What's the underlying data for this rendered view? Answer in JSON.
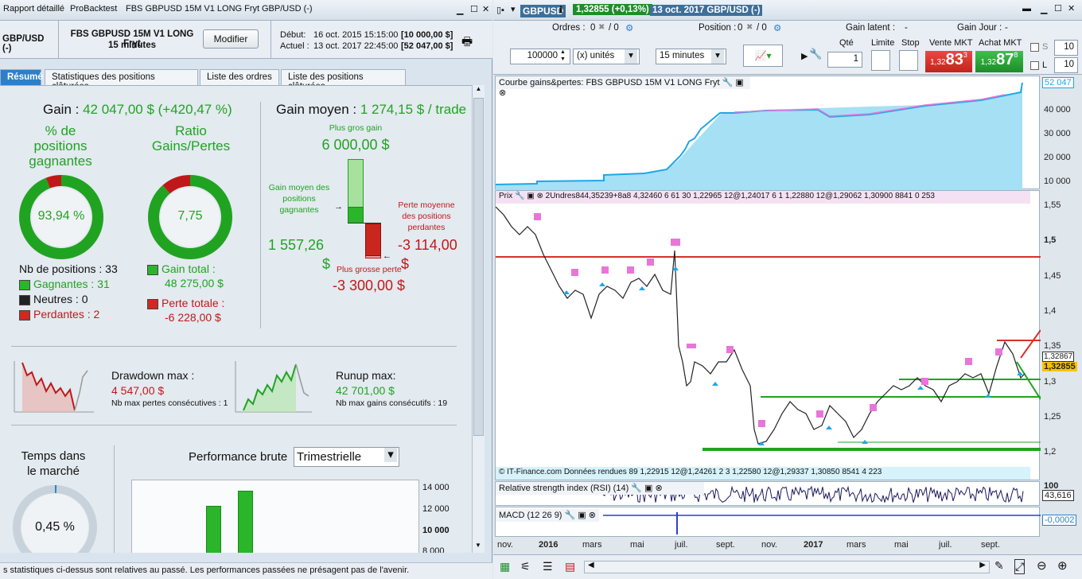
{
  "left": {
    "tabs": [
      "Rapport détaillé",
      "ProBacktest",
      "FBS GBPUSD 15M V1 LONG Fryt",
      "GBP/USD (-)"
    ],
    "instrument": "GBP/USD (-)",
    "strategy": "FBS GBPUSD 15M V1 LONG Fryt",
    "timeframe": "15 minutes",
    "modify_label": "Modifier",
    "start_label": "Début:",
    "start_date": "16 oct. 2015 15:15:00",
    "start_value": "[10 000,00 $]",
    "end_label": "Actuel :",
    "end_date": "13 oct. 2017 22:45:00",
    "end_value": "[52 047,00 $]",
    "report_tabs": [
      "Résumé",
      "Statistiques des positions clôturées",
      "Liste des ordres",
      "Liste des positions clôturées"
    ],
    "gain_label": "Gain :",
    "gain_value": "42 047,00 $ (+420,47 %)",
    "pct_win_title_1": "% de",
    "pct_win_title_2": "positions",
    "pct_win_title_3": "gagnantes",
    "pct_win_value": "93,94 %",
    "pct_win_fraction": 0.9394,
    "ratio_title_1": "Ratio",
    "ratio_title_2": "Gains/Pertes",
    "ratio_value": "7,75",
    "ratio_fraction": 0.886,
    "nb_pos": "Nb de positions : 33",
    "winners": "Gagnantes : 31",
    "neutral": "Neutres : 0",
    "losers": "Perdantes : 2",
    "gain_total_label": "Gain total :",
    "gain_total": "48 275,00 $",
    "loss_total_label": "Perte totale :",
    "loss_total": "-6 228,00 $",
    "avg_gain_label": "Gain moyen :",
    "avg_gain": "1 274,15 $ / trade",
    "biggest_gain_label": "Plus gros gain",
    "biggest_gain": "6 000,00 $",
    "avg_win_label_1": "Gain moyen des",
    "avg_win_label_2": "positions",
    "avg_win_label_3": "gagnantes",
    "avg_win_value_1": "1 557,26",
    "avg_win_value_2": "$",
    "avg_loss_label_1": "Perte moyenne",
    "avg_loss_label_2": "des positions",
    "avg_loss_label_3": "perdantes",
    "avg_loss_value_1": "-3 114,00",
    "avg_loss_value_2": "$",
    "biggest_loss_label": "Plus grosse perte",
    "biggest_loss": "-3 300,00 $",
    "drawdown_label": "Drawdown max :",
    "drawdown": "4 547,00 $",
    "drawdown_sub": "Nb max pertes consécutives : 1",
    "runup_label": "Runup max:",
    "runup": "42 701,00 $",
    "runup_sub": "Nb max gains consécutifs : 19",
    "time_title_1": "Temps dans",
    "time_title_2": "le marché",
    "time_value": "0,45 %",
    "time_fraction": 0.0045,
    "perf_label": "Performance brute",
    "perf_select": "Trimestrielle",
    "perf_axis": [
      "14 000",
      "12 000",
      "10 000",
      "8 000"
    ],
    "footer": "s statistiques ci-dessus sont relatives au passé. Les performances passées ne présagent pas de l'avenir."
  },
  "right": {
    "symbol": "GBPUSD",
    "price": "1,32855 (+0,13%)",
    "date": "13 oct. 2017 GBP/USD (-)",
    "orders_label": "Ordres :",
    "orders_a": "0",
    "orders_b": "/ 0",
    "position_label": "Position :",
    "position_a": "0",
    "position_b": "/ 0",
    "latent_label": "Gain latent :",
    "latent_value": "-",
    "day_label": "Gain Jour :",
    "day_value": "-",
    "qty_field": "100000",
    "units": "(x) unités",
    "tf": "15 minutes",
    "qte_label": "Qté",
    "qte_value": "1",
    "limit_label": "Limite",
    "stop_label": "Stop",
    "sell_label": "Vente MKT",
    "sell_small": "1,32",
    "sell_big": "83",
    "sell_sup": "3",
    "buy_label": "Achat MKT",
    "buy_small": "1,32",
    "buy_big": "87",
    "buy_sup": "8",
    "s_label": "S",
    "s_value": "10",
    "l_label": "L",
    "l_value": "10",
    "equity_title": "Courbe gains&pertes: FBS GBPUSD 15M V1 LONG Fryt",
    "equity_axis": [
      "52 047",
      "40 000",
      "30 000",
      "20 000",
      "10 000"
    ],
    "price_title": "Prix",
    "price_info": "2Undres844,35239+8a8 4,32460 6 61 30 1,22965 12@1,24017 6 1 1,22880 12@1,29062 1,30900 8841 0 253",
    "price_info2": "© IT-Finance.com Données rendues 89 1,22915 12@1,24261 2 3 1,22580 12@1,29337 1,30850 8541 4 223",
    "price_axis": [
      "1,55",
      "1,5",
      "1,45",
      "1,4",
      "1,35",
      "1,3",
      "1,25",
      "1,2"
    ],
    "current_price": "1,32855",
    "price_tag2": "1,32867",
    "rsi_title": "Relative strength index (RSI) (14)",
    "rsi_top": "100",
    "rsi_value": "43,616",
    "macd_title": "MACD (12 26 9)",
    "macd_value": "-0,0002",
    "x_axis": [
      "nov.",
      "2016",
      "mars",
      "mai",
      "juil.",
      "sept.",
      "nov.",
      "2017",
      "mars",
      "mai",
      "juil.",
      "sept."
    ],
    "colors": {
      "equity_fill": "#9ddcf5",
      "equity_line": "#1ea7e6",
      "buy": "#21a322",
      "sell": "#d9302c"
    }
  }
}
